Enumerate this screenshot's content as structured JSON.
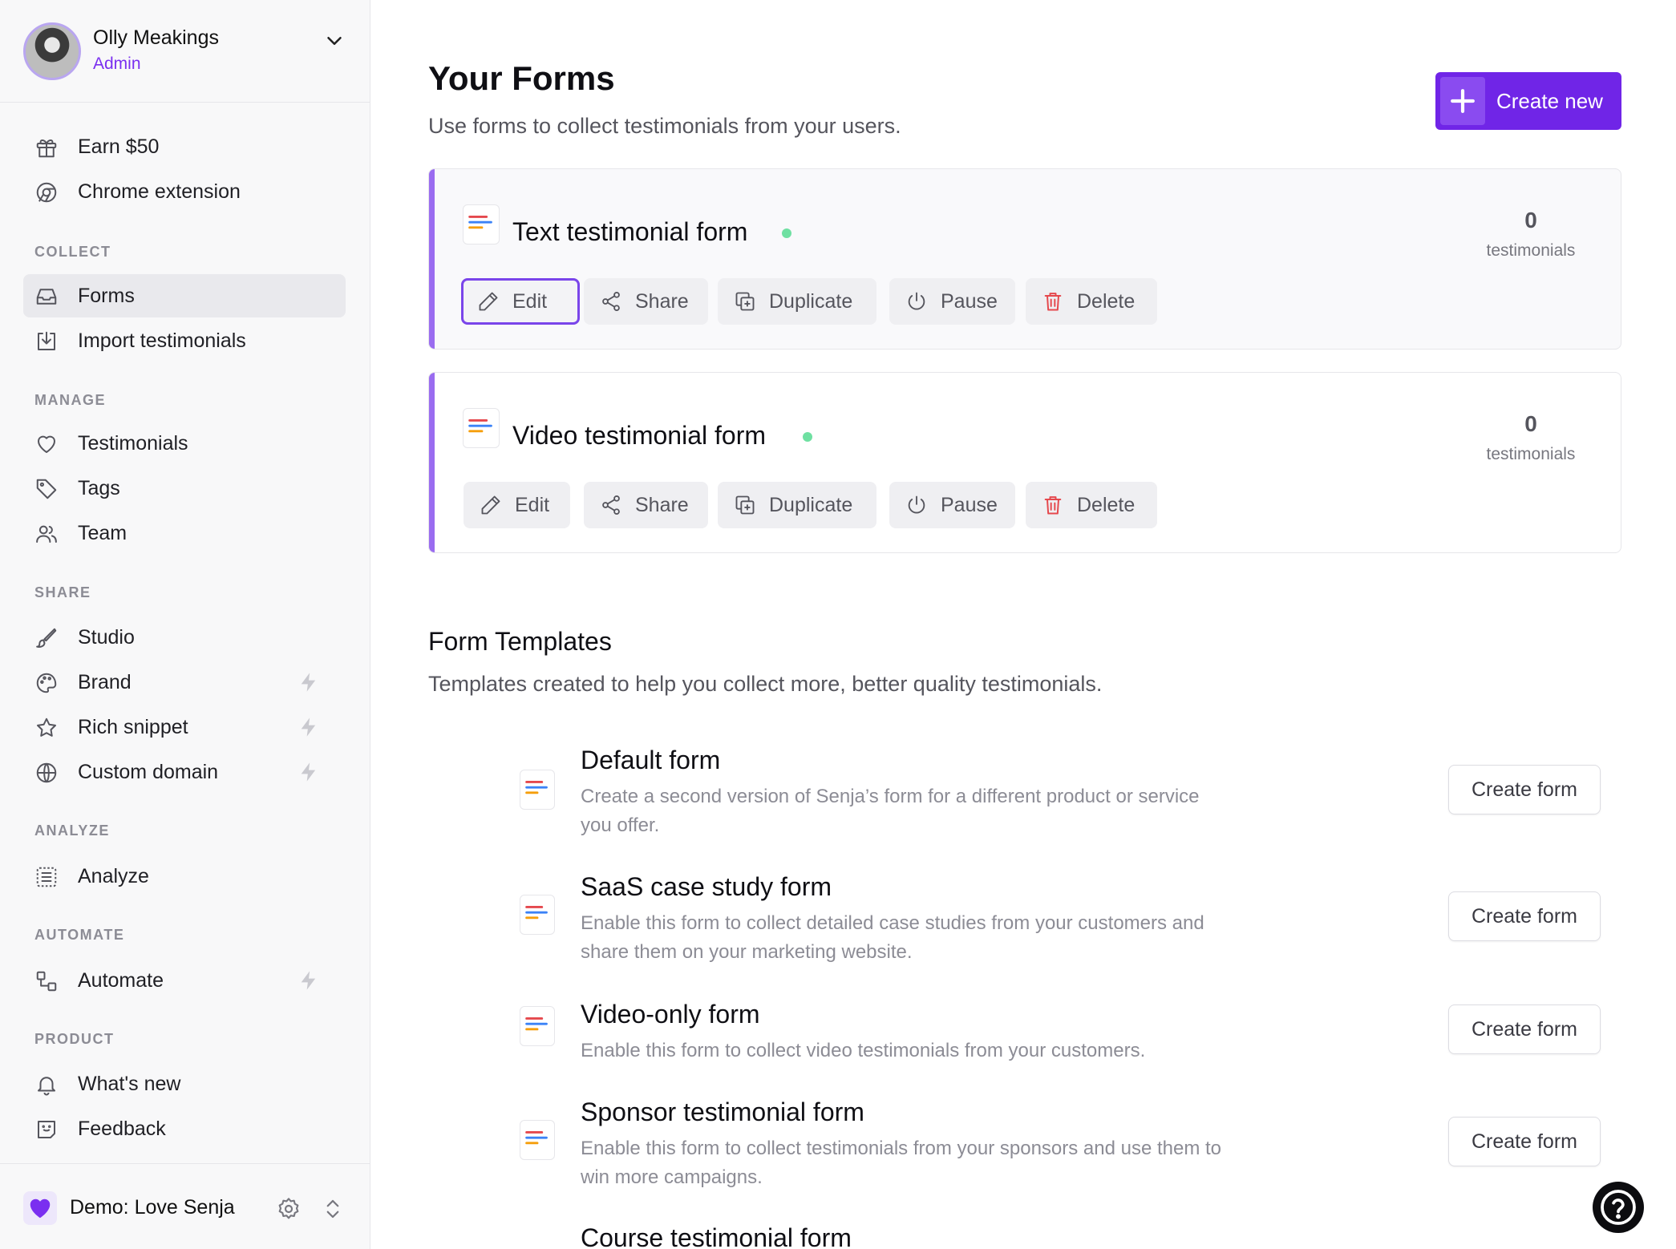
{
  "user": {
    "name": "Olly Meakings",
    "role": "Admin"
  },
  "sidebar": {
    "top_items": [
      {
        "label": "Earn $50",
        "icon": "gift-icon"
      },
      {
        "label": "Chrome extension",
        "icon": "chrome-icon"
      }
    ],
    "sections": [
      {
        "label": "COLLECT",
        "items": [
          {
            "label": "Forms",
            "icon": "inbox-icon",
            "active": true
          },
          {
            "label": "Import testimonials",
            "icon": "import-icon"
          }
        ]
      },
      {
        "label": "MANAGE",
        "items": [
          {
            "label": "Testimonials",
            "icon": "heart-icon"
          },
          {
            "label": "Tags",
            "icon": "tag-icon"
          },
          {
            "label": "Team",
            "icon": "users-icon"
          }
        ]
      },
      {
        "label": "SHARE",
        "items": [
          {
            "label": "Studio",
            "icon": "brush-icon"
          },
          {
            "label": "Brand",
            "icon": "palette-icon",
            "pro": true
          },
          {
            "label": "Rich snippet",
            "icon": "star-icon",
            "pro": true
          },
          {
            "label": "Custom domain",
            "icon": "globe-icon",
            "pro": true
          }
        ]
      },
      {
        "label": "ANALYZE",
        "items": [
          {
            "label": "Analyze",
            "icon": "list-icon"
          }
        ]
      },
      {
        "label": "AUTOMATE",
        "items": [
          {
            "label": "Automate",
            "icon": "workflow-icon",
            "pro": true
          }
        ]
      },
      {
        "label": "PRODUCT",
        "items": [
          {
            "label": "What's new",
            "icon": "bell-icon"
          },
          {
            "label": "Feedback",
            "icon": "feedback-icon"
          }
        ]
      }
    ]
  },
  "workspace": {
    "name": "Demo: Love Senja"
  },
  "header": {
    "title": "Your Forms",
    "subtitle": "Use forms to collect testimonials from your users.",
    "create_new": "Create new"
  },
  "forms": [
    {
      "title": "Text testimonial form",
      "count": "0",
      "count_label": "testimonials",
      "status_color": "#6fe0a2"
    },
    {
      "title": "Video testimonial form",
      "count": "0",
      "count_label": "testimonials",
      "status_color": "#6fe0a2"
    }
  ],
  "form_actions": {
    "edit": "Edit",
    "share": "Share",
    "duplicate": "Duplicate",
    "pause": "Pause",
    "delete": "Delete"
  },
  "templates": {
    "title": "Form Templates",
    "subtitle": "Templates created to help you collect more, better quality testimonials.",
    "button_label": "Create form",
    "items": [
      {
        "title": "Default form",
        "description": "Create a second version of Senja’s form for a different product or service you offer."
      },
      {
        "title": "SaaS case study form",
        "description": "Enable this form to collect detailed case studies from your customers and share them on your marketing website."
      },
      {
        "title": "Video-only form",
        "description": "Enable this form to collect video testimonials from your customers."
      },
      {
        "title": "Sponsor testimonial form",
        "description": "Enable this form to collect testimonials from your sponsors and use them to win more campaigns."
      },
      {
        "title": "Course testimonial form",
        "description": ""
      }
    ]
  },
  "colors": {
    "accent": "#7025e7",
    "delete": "#e5484d",
    "status": "#6fe0a2"
  }
}
